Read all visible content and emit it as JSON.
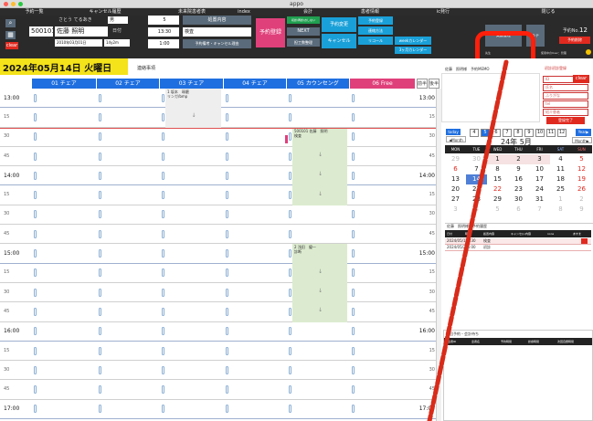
{
  "window": {
    "title": "appo"
  },
  "menu": [
    "予約一覧",
    "キャンセル履歴",
    "未来院患者表",
    "index",
    "会計",
    "患者情報",
    "ic発行",
    "閉じる"
  ],
  "header": {
    "patient_id": "500101",
    "patient_name": "佐藤 照明",
    "kana": "さとう てるあき",
    "gender": "男",
    "birthdate": "2010年03月01日",
    "age": "14y2m",
    "date_label": "日付",
    "clear": "clear",
    "duration": "5",
    "time": "13:30",
    "exam_type": "検査",
    "interval": "1:00",
    "menu_label": "処置内容",
    "memo_label": "予約備考・キャンセル理由",
    "register": "予約登録",
    "next_label": "NEXT",
    "staff_label": "担工数整理",
    "small_note": "初診/再診/おしない",
    "change": "予約変更",
    "cancel": "キャンセル",
    "notify_method": "連絡方法",
    "recall": "リコール",
    "reserve_list": "予約登録",
    "week_calendar": "weekカレンダー",
    "month3_calendar": "3ヶ月カレンダー",
    "actual_mgmt": "実績管理",
    "sub_label": "先生",
    "other_btn": "ルテ",
    "res_no_label": "予約No.",
    "res_no": "12",
    "delete_res": "予約削除",
    "user_label": "使用中のUser：管理"
  },
  "schedule": {
    "date": "2024年05月14日 火曜日",
    "note": "連絡事項",
    "columns": [
      {
        "label": "01 チェア",
        "color": "#1f6fe0"
      },
      {
        "label": "02 チェア",
        "color": "#1f6fe0"
      },
      {
        "label": "03 チェア",
        "color": "#1f6fe0"
      },
      {
        "label": "04 チェア",
        "color": "#1f6fe0"
      },
      {
        "label": "05 カウンセング",
        "color": "#1f6fe0"
      },
      {
        "label": "06 Free",
        "color": "#e0407a"
      }
    ],
    "nav_prev": "前半",
    "nav_next": "後半",
    "slots": [
      "13:00",
      "15",
      "30",
      "45",
      "14:00",
      "15",
      "30",
      "45",
      "15:00",
      "15",
      "30",
      "45",
      "16:00",
      "15",
      "30",
      "45",
      "17:00"
    ],
    "appointments": [
      {
        "col": 2,
        "text": "1 坂本　琢磨\nリンガ/bmp"
      },
      {
        "col": 4,
        "text": "500101 佐藤　照明\n検査"
      },
      {
        "col": 4,
        "text": "2 浅田　優一\n診断"
      }
    ]
  },
  "right_panel": {
    "patient_line": "佐藤　照明様　予約MEMO",
    "new_patient": "初診初診登録",
    "id_label": "ID",
    "clear": "clear",
    "name_ph": "氏名",
    "kana_ph": "ふりがな",
    "tel_ph": "tel",
    "referrer_ph": "紹介患者",
    "register_btn": "登録完了",
    "today": "today",
    "month_prev": "◀Month",
    "month_next": "Month▶",
    "year_next": "Year▶",
    "months": [
      "4",
      "5",
      "6",
      "7",
      "8",
      "9",
      "10",
      "11",
      "12"
    ],
    "cal_title": "24年 5月",
    "weekdays": [
      "MON",
      "TUE",
      "WED",
      "THU",
      "FRI",
      "SAT",
      "SUN"
    ],
    "weeks": [
      [
        "29",
        "30",
        "1",
        "2",
        "3",
        "4",
        "5"
      ],
      [
        "6",
        "7",
        "8",
        "9",
        "10",
        "11",
        "12"
      ],
      [
        "13",
        "14",
        "15",
        "16",
        "17",
        "18",
        "19"
      ],
      [
        "20",
        "21",
        "22",
        "23",
        "24",
        "25",
        "26"
      ],
      [
        "27",
        "28",
        "29",
        "30",
        "31",
        "1",
        "2"
      ],
      [
        "3",
        "4",
        "5",
        "6",
        "7",
        "8",
        "9"
      ]
    ],
    "history_title": "佐藤　照明様　予約履歴",
    "history_headers": [
      "日付",
      "時刻",
      "処置内容",
      "キャンセル/内容",
      "none",
      "あすま"
    ],
    "history_rows": [
      {
        "date": "2024/05/14",
        "time": "13:30",
        "treatment": "検査"
      },
      {
        "date": "2024/05/24",
        "time": "14:00",
        "treatment": "初診"
      }
    ],
    "next_title": "次回予約・会計待ち",
    "next_headers": [
      "患者ID",
      "患者名",
      "予約時間",
      "診療時間",
      "次回自費時間"
    ]
  },
  "colors": {
    "highlight": "#ff1f0a",
    "annotation": "#d92b1a",
    "accent": "#1f6fe0",
    "free": "#e0407a",
    "register": "#e0407a",
    "today_band": "#f4e21a"
  }
}
